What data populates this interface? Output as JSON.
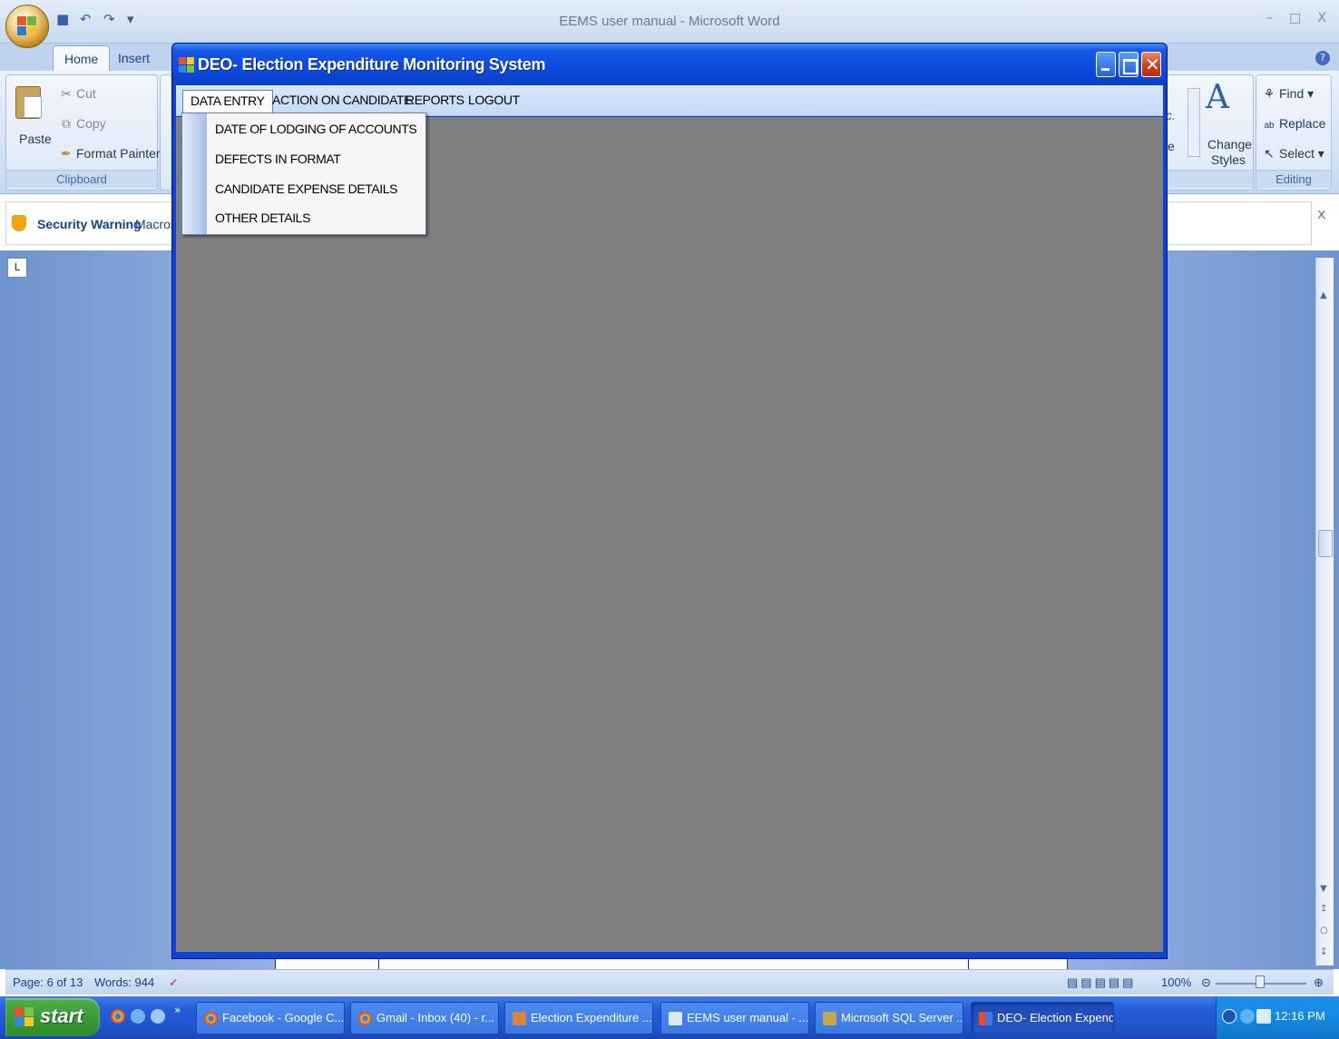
{
  "word": {
    "title": "EEMS user manual - Microsoft Word",
    "tabs": [
      "Home",
      "Insert"
    ],
    "clipboard": {
      "paste": "Paste",
      "cut": "Cut",
      "copy": "Copy",
      "format_painter": "Format Painter",
      "group_name": "Clipboard"
    },
    "styles": {
      "change_styles": "Change Styles",
      "partial_left": "c.",
      "partial_e": "e"
    },
    "editing": {
      "find": "Find",
      "replace": "Replace",
      "select": "Select",
      "group_name": "Editing"
    },
    "security": {
      "title": "Security Warning",
      "text": "Macros"
    },
    "status": {
      "page": "Page: 6 of 13",
      "words": "Words: 944",
      "zoom": "100%"
    }
  },
  "app": {
    "title": "DEO- Election Expenditure Monitoring System",
    "menu": [
      {
        "label": "DATA ENTRY",
        "active": true
      },
      {
        "label": "ACTION ON CANDIDATE"
      },
      {
        "label": "REPORTS"
      },
      {
        "label": "LOGOUT"
      }
    ],
    "dropdown": [
      "DATE OF LODGING OF ACCOUNTS",
      "DEFECTS IN FORMAT",
      "CANDIDATE EXPENSE DETAILS",
      "OTHER DETAILS"
    ],
    "client_bg": "#808080",
    "titlebar_color": "#0a4be0"
  },
  "taskbar": {
    "start": "start",
    "buttons": [
      {
        "label": "Facebook - Google C...",
        "icon": "chrome-icon"
      },
      {
        "label": "Gmail - Inbox (40) - r...",
        "icon": "chrome-icon"
      },
      {
        "label": "Election Expenditure ...",
        "icon": "app-icon"
      },
      {
        "label": "EEMS user manual - ...",
        "icon": "word-icon"
      },
      {
        "label": "Microsoft SQL Server ...",
        "icon": "sql-icon"
      },
      {
        "label": "DEO- Election Expend...",
        "icon": "app-icon",
        "active": true
      }
    ],
    "clock": "12:16 PM"
  }
}
